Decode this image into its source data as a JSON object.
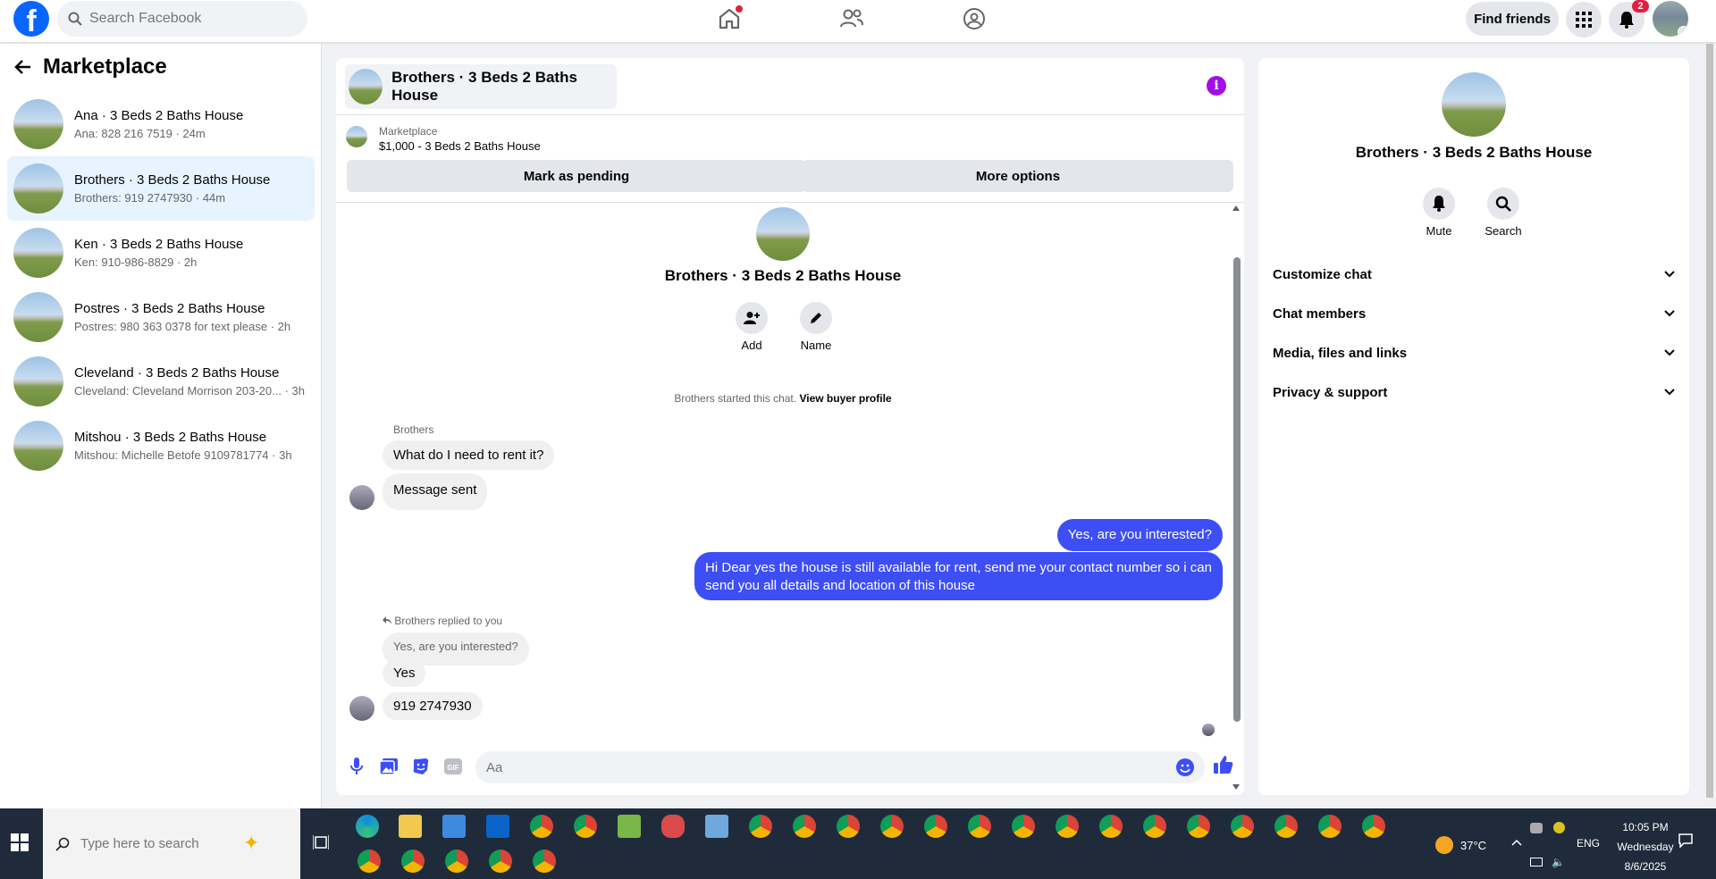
{
  "topbar": {
    "search_placeholder": "Search Facebook",
    "find_friends": "Find friends",
    "notification_count": "2",
    "brand_color": "#0866ff"
  },
  "sidebar": {
    "title": "Marketplace",
    "conversations": [
      {
        "name": "Ana · 3 Beds 2 Baths House",
        "sub": "Ana: 828 216 7519 · 24m"
      },
      {
        "name": "Brothers · 3 Beds 2 Baths House",
        "sub": "Brothers: 919 2747930 · 44m"
      },
      {
        "name": "Ken · 3 Beds 2 Baths House",
        "sub": "Ken: 910-986-8829 · 2h"
      },
      {
        "name": "Postres · 3 Beds 2 Baths House",
        "sub": "Postres: 980 363 0378 for text please · 2h"
      },
      {
        "name": "Cleveland · 3 Beds 2 Baths House",
        "sub": "Cleveland: Cleveland Morrison 203-20... · 3h"
      },
      {
        "name": "Mitshou · 3 Beds 2 Baths House",
        "sub": "Mitshou: Michelle Betofe 9109781774 · 3h"
      }
    ]
  },
  "chat": {
    "header_title": "Brothers · 3 Beds 2 Baths House",
    "marketplace_label": "Marketplace",
    "listing": "$1,000 - 3 Beds 2 Baths House",
    "mark_pending": "Mark as pending",
    "more_options": "More options",
    "title": "Brothers · 3 Beds 2 Baths House",
    "add_label": "Add",
    "name_label": "Name",
    "started_text": "Brothers started this chat.",
    "view_buyer_profile": "View buyer profile",
    "sender": "Brothers",
    "msg1": "What do I need to rent it?",
    "msg2": "Message sent",
    "out1": "Yes, are you interested?",
    "out2_line1": "Hi Dear yes the house is still available for rent, send me your contact number so i can",
    "out2_line2": "send you all details and location of this house",
    "replied_label": "Brothers replied to you",
    "quoted": "Yes, are you interested?",
    "reply": "Yes",
    "phone": "919 2747930",
    "composer_placeholder": "Aa",
    "accent_color": "#3d4ef5"
  },
  "details": {
    "title": "Brothers · 3 Beds 2 Baths House",
    "mute": "Mute",
    "search": "Search",
    "sections": [
      "Customize chat",
      "Chat members",
      "Media, files and links",
      "Privacy & support"
    ]
  },
  "taskbar": {
    "search_placeholder": "Type here to search",
    "temperature": "37°C",
    "language": "ENG",
    "time": "10:05 PM",
    "day": "Wednesday",
    "date": "8/6/2025"
  }
}
